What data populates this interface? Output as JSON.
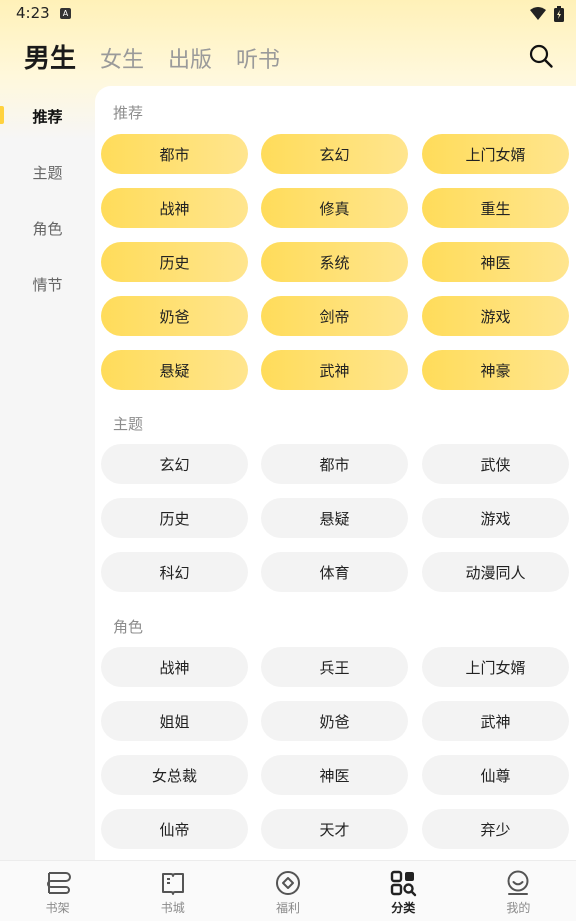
{
  "status": {
    "time": "4:23",
    "a_badge": "A"
  },
  "tabs": [
    "男生",
    "女生",
    "出版",
    "听书"
  ],
  "sidebar": {
    "items": [
      "推荐",
      "主题",
      "角色",
      "情节"
    ]
  },
  "sections": [
    {
      "title": "推荐",
      "style": "yellow",
      "tags": [
        "都市",
        "玄幻",
        "上门女婿",
        "战神",
        "修真",
        "重生",
        "历史",
        "系统",
        "神医",
        "奶爸",
        "剑帝",
        "游戏",
        "悬疑",
        "武神",
        "神豪"
      ]
    },
    {
      "title": "主题",
      "style": "gray",
      "tags": [
        "玄幻",
        "都市",
        "武侠",
        "历史",
        "悬疑",
        "游戏",
        "科幻",
        "体育",
        "动漫同人"
      ]
    },
    {
      "title": "角色",
      "style": "gray",
      "tags": [
        "战神",
        "兵王",
        "上门女婿",
        "姐姐",
        "奶爸",
        "武神",
        "女总裁",
        "神医",
        "仙尊",
        "仙帝",
        "天才",
        "弃少"
      ]
    }
  ],
  "bottom_nav": [
    {
      "label": "书架",
      "icon": "bookshelf-icon"
    },
    {
      "label": "书城",
      "icon": "book-city-icon"
    },
    {
      "label": "福利",
      "icon": "welfare-icon"
    },
    {
      "label": "分类",
      "icon": "category-icon"
    },
    {
      "label": "我的",
      "icon": "profile-icon"
    }
  ],
  "colors": {
    "accent": "#ffd23f",
    "chip_yellow_start": "#ffdc5a",
    "chip_yellow_end": "#ffe58e",
    "chip_gray": "#f3f3f3"
  }
}
